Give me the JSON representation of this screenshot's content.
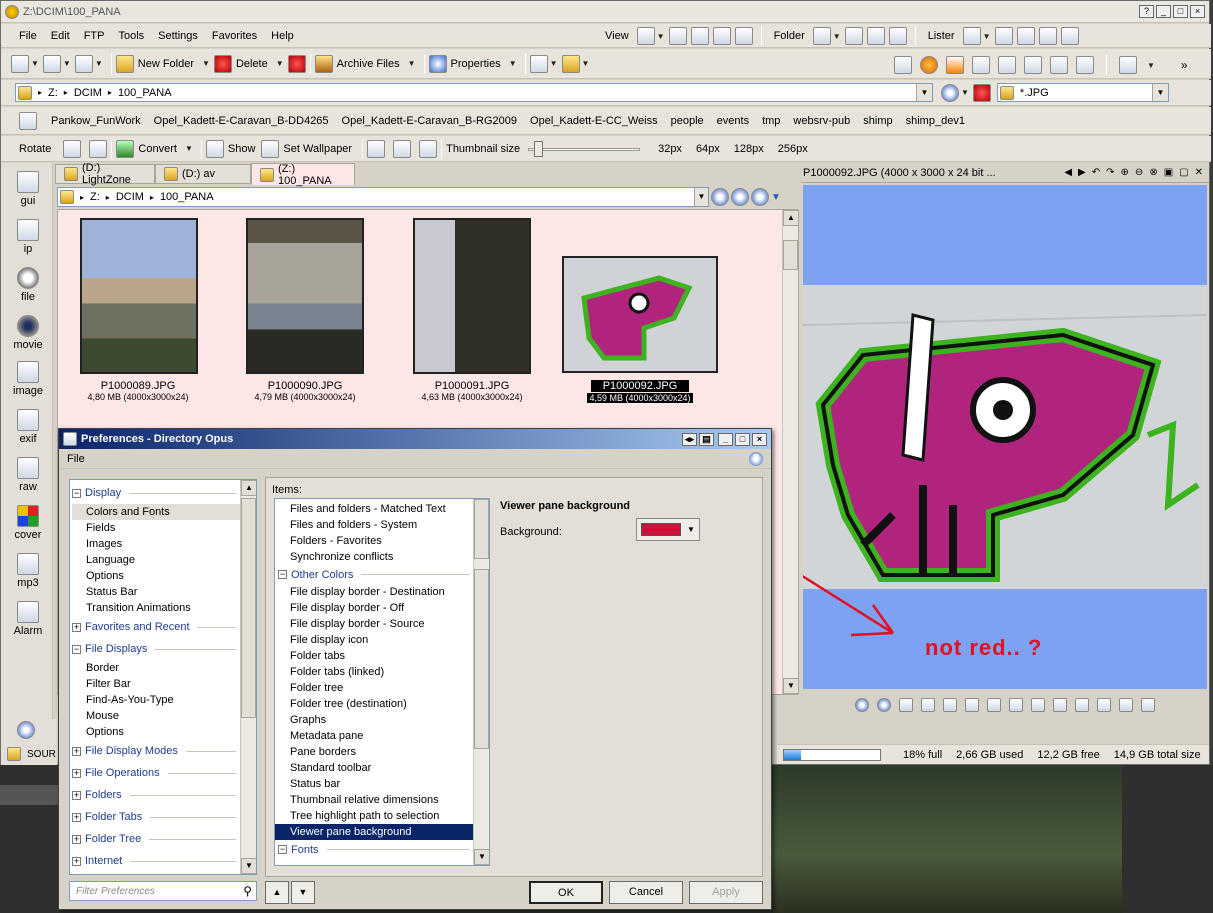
{
  "window": {
    "title": "Z:\\DCIM\\100_PANA",
    "controls": [
      "?",
      "_",
      "□",
      "×"
    ]
  },
  "menu": [
    "File",
    "Edit",
    "FTP",
    "Tools",
    "Settings",
    "Favorites",
    "Help"
  ],
  "menu_right": {
    "view": "View",
    "folder": "Folder",
    "lister": "Lister"
  },
  "toolbar1": {
    "new_folder": "New Folder",
    "delete": "Delete",
    "archive": "Archive Files",
    "properties": "Properties"
  },
  "address": {
    "crumbs": [
      "Z:",
      "DCIM",
      "100_PANA"
    ],
    "filter": "*.JPG"
  },
  "favorites": [
    "Pankow_FunWork",
    "Opel_Kadett-E-Caravan_B-DD4265",
    "Opel_Kadett-E-Caravan_B-RG2009",
    "Opel_Kadett-E-CC_Weiss",
    "people",
    "events",
    "tmp",
    "websrv-pub",
    "shimp",
    "shimp_dev1"
  ],
  "toolbar3": {
    "rotate": "Rotate",
    "convert": "Convert",
    "show": "Show",
    "wallpaper": "Set Wallpaper",
    "thumb_size": "Thumbnail size",
    "sizes": [
      "32px",
      "64px",
      "128px",
      "256px"
    ],
    "slider_pct": 5
  },
  "sidebar": [
    "gui",
    "ip",
    "file",
    "movie",
    "image",
    "exif",
    "raw",
    "cover",
    "mp3",
    "Alarm"
  ],
  "tabs": [
    "(D:) LightZone",
    "(D:) av",
    "(Z:) 100_PANA"
  ],
  "path2": [
    "Z:",
    "DCIM",
    "100_PANA"
  ],
  "files": [
    {
      "name": "P1000089.JPG",
      "info": "4,80 MB (4000x3000x24)"
    },
    {
      "name": "P1000090.JPG",
      "info": "4,79 MB (4000x3000x24)"
    },
    {
      "name": "P1000091.JPG",
      "info": "4,63 MB (4000x3000x24)"
    },
    {
      "name": "P1000092.JPG",
      "info": "4,59 MB (4000x3000x24)"
    }
  ],
  "viewer": {
    "title": "P1000092.JPG (4000 x 3000 x 24 bit ...",
    "annotation": "not red.. ?"
  },
  "status": {
    "source": "SOUR",
    "full": "18% full",
    "used": "2,66 GB used",
    "free": "12,2 GB free",
    "total": "14,9 GB total size",
    "fill_pct": 18
  },
  "dialog": {
    "title": "Preferences - Directory Opus",
    "menu": "File",
    "tree": [
      {
        "label": "Display",
        "group": true,
        "expanded": true
      },
      {
        "label": "Colors and Fonts",
        "selected": true
      },
      {
        "label": "Fields"
      },
      {
        "label": "Images"
      },
      {
        "label": "Language"
      },
      {
        "label": "Options"
      },
      {
        "label": "Status Bar"
      },
      {
        "label": "Transition Animations"
      },
      {
        "label": "Favorites and Recent",
        "group": true
      },
      {
        "label": "File Displays",
        "group": true,
        "expanded": true
      },
      {
        "label": "Border"
      },
      {
        "label": "Filter Bar"
      },
      {
        "label": "Find-As-You-Type"
      },
      {
        "label": "Mouse"
      },
      {
        "label": "Options"
      },
      {
        "label": "File Display Modes",
        "group": true
      },
      {
        "label": "File Operations",
        "group": true
      },
      {
        "label": "Folders",
        "group": true
      },
      {
        "label": "Folder Tabs",
        "group": true
      },
      {
        "label": "Folder Tree",
        "group": true
      },
      {
        "label": "Internet",
        "group": true
      }
    ],
    "filter_placeholder": "Filter Preferences",
    "items_label": "Items:",
    "items": [
      {
        "label": "Files and folders - Matched Text"
      },
      {
        "label": "Files and folders - System"
      },
      {
        "label": "Folders - Favorites"
      },
      {
        "label": "Synchronize conflicts"
      },
      {
        "label": "Other Colors",
        "group": true
      },
      {
        "label": "File display border - Destination"
      },
      {
        "label": "File display border - Off"
      },
      {
        "label": "File display border - Source"
      },
      {
        "label": "File display icon"
      },
      {
        "label": "Folder tabs"
      },
      {
        "label": "Folder tabs (linked)"
      },
      {
        "label": "Folder tree"
      },
      {
        "label": "Folder tree (destination)"
      },
      {
        "label": "Graphs"
      },
      {
        "label": "Metadata pane"
      },
      {
        "label": "Pane borders"
      },
      {
        "label": "Standard toolbar"
      },
      {
        "label": "Status bar"
      },
      {
        "label": "Thumbnail relative dimensions"
      },
      {
        "label": "Tree highlight path to selection"
      },
      {
        "label": "Viewer pane background",
        "selected": true
      },
      {
        "label": "Fonts",
        "group": true
      }
    ],
    "detail_title": "Viewer pane background",
    "background_label": "Background:",
    "swatch_color": "#d0103a",
    "ok": "OK",
    "cancel": "Cancel",
    "apply": "Apply"
  },
  "colors": {
    "viewer_bg": "#7ea2f2",
    "file_bg": "#fde6e6",
    "selection": "#0a246a",
    "annotation": "#e01020",
    "title_grad_start": "#0a246a",
    "title_grad_end": "#a6caf0"
  }
}
